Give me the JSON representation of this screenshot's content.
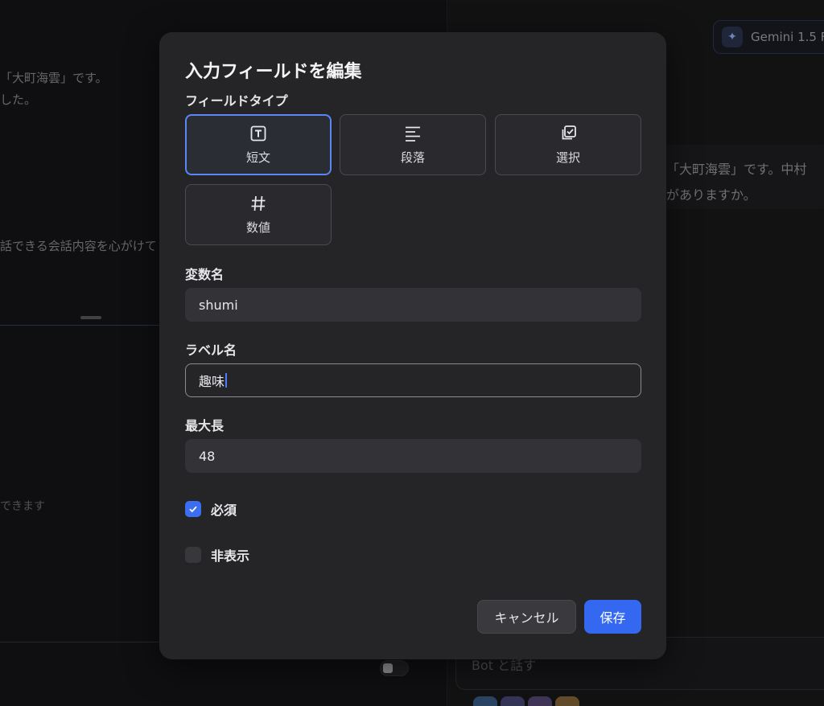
{
  "background": {
    "left_texts": [
      "「大町海雲」です。",
      "した。",
      "話できる会話内容を心がけて",
      "できます"
    ],
    "model_name": "Gemini 1.5 F",
    "right_texts": [
      "「大町海雲」です。中村",
      "がありますか。"
    ],
    "bot_input_placeholder": "Bot と話す"
  },
  "modal": {
    "title": "入力フィールドを編集",
    "field_type_label": "フィールドタイプ",
    "field_types": [
      {
        "label": "短文",
        "icon": "text-box-icon",
        "selected": true
      },
      {
        "label": "段落",
        "icon": "paragraph-lines-icon",
        "selected": false
      },
      {
        "label": "選択",
        "icon": "select-check-icon",
        "selected": false
      },
      {
        "label": "数値",
        "icon": "hash-icon",
        "selected": false
      }
    ],
    "variable_name": {
      "label": "変数名",
      "value": "shumi"
    },
    "label_name": {
      "label": "ラベル名",
      "value": "趣味"
    },
    "max_length": {
      "label": "最大長",
      "value": "48"
    },
    "required": {
      "label": "必須",
      "checked": true
    },
    "hidden": {
      "label": "非表示",
      "checked": false
    },
    "cancel_label": "キャンセル",
    "save_label": "保存"
  },
  "colors": {
    "accent": "#3468f0",
    "selected_border": "#5b86f5",
    "modal_bg": "#252528"
  }
}
